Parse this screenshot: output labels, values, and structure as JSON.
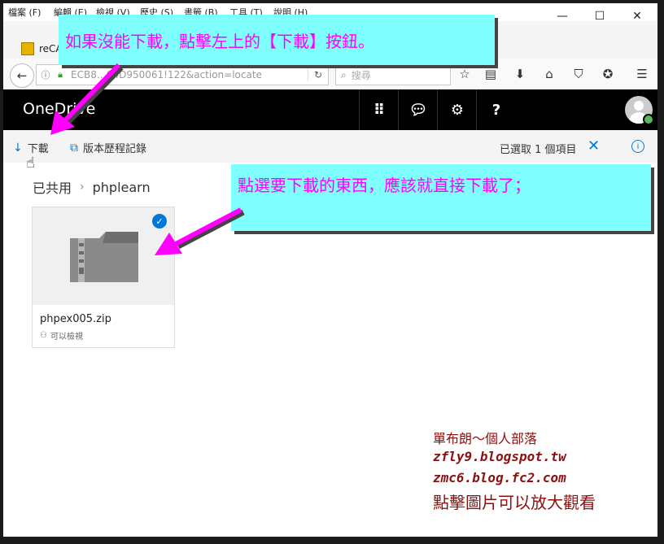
{
  "menu": [
    "檔案 (F)",
    "編輯 (E)",
    "檢視 (V)",
    "歷史 (S)",
    "書籤 (B)",
    "工具 (T)",
    "說明 (H)"
  ],
  "window_controls": {
    "minimize": "—",
    "maximize": "☐",
    "close": "✕"
  },
  "tab": {
    "label": "reCA"
  },
  "nav": {
    "url": "ECB8…94D950061!122&action=locate",
    "search_placeholder": "搜尋"
  },
  "onedrive": {
    "title": "OneDrive"
  },
  "commands": {
    "download": "下載",
    "version_history": "版本歷程記錄",
    "selected": "已選取 1 個項目"
  },
  "breadcrumb": {
    "root": "已共用",
    "current": "phplearn"
  },
  "file": {
    "name": "phpex005.zip",
    "permission": "可以檢視"
  },
  "callouts": {
    "top": "如果沒能下載，點擊左上的【下載】按鈕。",
    "middle": "點選要下載的東西，應該就直接下載了；"
  },
  "signature": {
    "line1": "單布朗～個人部落",
    "line2": "zfly9.blogspot.tw",
    "line3": "zmc6.blog.fc2.com",
    "line4": "點擊圖片可以放大觀看"
  },
  "colors": {
    "callout_bg": "#80ffff",
    "callout_text": "#ff00ff",
    "arrow": "#ff00ff",
    "onedrive_header": "#000000",
    "accent": "#0078d7",
    "signature": "#8b1010"
  }
}
